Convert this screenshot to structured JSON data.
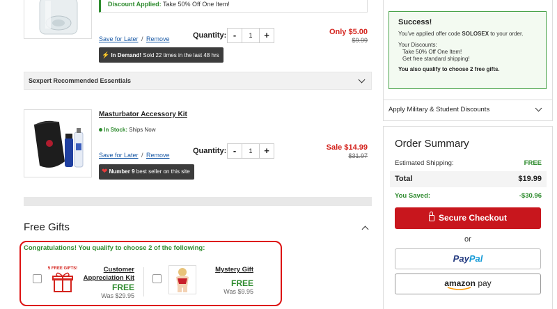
{
  "item1": {
    "discount_label": "Discount Applied:",
    "discount_text": "Take 50% Off One Item!",
    "save_for_later": "Save for Later",
    "separator": "/",
    "remove": "Remove",
    "quantity_label": "Quantity:",
    "minus": "-",
    "quantity": "1",
    "plus": "+",
    "price_label": "Only $5.00",
    "original_price": "$9.99",
    "badge_bold": "In Demand!",
    "badge_text": "Sold 22 times in the last 48 hrs"
  },
  "recommended": {
    "label": "Sexpert Recommended Essentials"
  },
  "item2": {
    "name": "Masturbator Accessory Kit",
    "stock_bold": "In Stock:",
    "stock_text": "Ships Now",
    "save_for_later": "Save for Later",
    "separator": "/",
    "remove": "Remove",
    "quantity_label": "Quantity:",
    "minus": "-",
    "quantity": "1",
    "plus": "+",
    "price_label": "Sale $14.99",
    "original_price": "$31.97",
    "badge_bold": "Number 9",
    "badge_text": "best seller on this site"
  },
  "free_gifts": {
    "title": "Free Gifts",
    "congrats": "Congratulations! You qualify to choose 2 of the following:",
    "gifts": [
      {
        "badge": "5 FREE GIFTS!",
        "name_line1": "Customer",
        "name_line2": "Appreciation Kit",
        "free": "FREE",
        "was": "Was $29.95"
      },
      {
        "name_line1": "Mystery Gift",
        "free": "FREE",
        "was": "Was $9.95"
      }
    ]
  },
  "success": {
    "title": "Success!",
    "line1_pre": "You've applied offer code ",
    "code": "SOLOSEX",
    "line1_post": " to your order.",
    "discounts_label": "Your Discounts:",
    "discount1": "Take 50% Off One Item!",
    "discount2": "Get free standard shipping!",
    "gifts_note": "You also qualify to choose 2 free gifts."
  },
  "military": {
    "label": "Apply Military & Student Discounts"
  },
  "summary": {
    "title": "Order Summary",
    "shipping_label": "Estimated Shipping:",
    "shipping_value": "FREE",
    "total_label": "Total",
    "total_value": "$19.99",
    "saved_label": "You Saved:",
    "saved_value": "-$30.96",
    "checkout_label": "Secure Checkout",
    "or": "or",
    "paypal_pay": "Pay",
    "paypal_pal": "Pal",
    "amazon": "amazon",
    "amazon_pay": "pay"
  },
  "colors": {
    "green": "#2e8b2e",
    "red": "#d4241e",
    "checkout_red": "#c8161d",
    "paypal_dark": "#253b80",
    "paypal_light": "#179bd7"
  }
}
